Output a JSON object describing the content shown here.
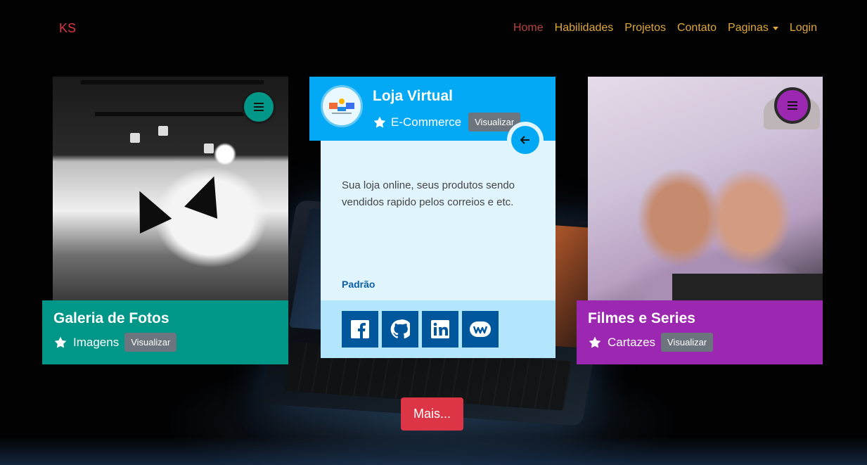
{
  "nav": {
    "brand": "KS",
    "items": [
      {
        "label": "Home",
        "active": true
      },
      {
        "label": "Habilidades"
      },
      {
        "label": "Projetos"
      },
      {
        "label": "Contato"
      },
      {
        "label": "Paginas",
        "dropdown": true
      },
      {
        "label": "Login"
      }
    ]
  },
  "cards": [
    {
      "title": "Galeria de Fotos",
      "category": "Imagens",
      "button": "Visualizar",
      "color": "#009688"
    },
    {
      "title": "Loja Virtual",
      "category": "E-Commerce",
      "button": "Visualizar",
      "color": "#03a9f4",
      "description": "Sua loja online, seus produtos sendo vendidos rapido pelos correios e etc.",
      "tag": "Padrão",
      "social": [
        "facebook-icon",
        "github-icon",
        "linkedin-icon",
        "weebly-icon"
      ]
    },
    {
      "title": "Filmes e Series",
      "category": "Cartazes",
      "button": "Visualizar",
      "color": "#9c27b0"
    }
  ],
  "more_button": "Mais...",
  "colors": {
    "accent": "#dc3545",
    "nav_link": "#e0a836"
  }
}
